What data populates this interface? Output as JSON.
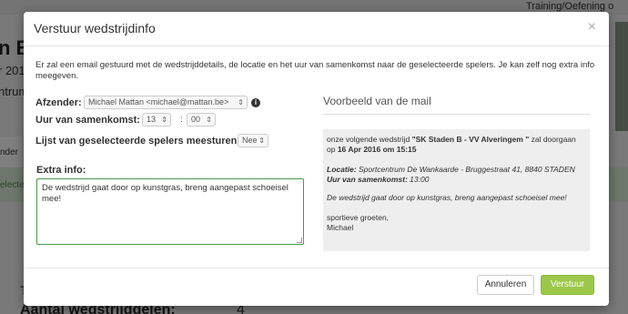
{
  "background": {
    "top_link": "Training/Oefening o",
    "title": "n B",
    "sub1": "r 201",
    "sub2": "ntrum",
    "tab_label": "nder",
    "green_label": "electe",
    "t_label": "T",
    "bottom_label": "Aantal wedstrijddelen:",
    "bottom_value": "4"
  },
  "modal": {
    "title": "Verstuur wedstrijdinfo",
    "close": "×",
    "intro": "Er zal een email gestuurd met de wedstrijddetails, de locatie en het uur van samenkomst naar de geselecteerde spelers. Je kan zelf nog extra info meegeven.",
    "form": {
      "sender_label": "Afzender:",
      "sender_value": "Michael Mattan <michael@mattan.be>",
      "info_icon": "i",
      "time_label": "Uur van samenkomst:",
      "hour": "13",
      "minute": "00",
      "players_label": "Lijst van geselecteerde spelers meesturen:",
      "players_value": "Nee",
      "extra_label": "Extra info:",
      "extra_text": "De wedstrijd gaat door op kunstgras, breng aangepast schoeisel mee!"
    },
    "preview": {
      "title": "Voorbeeld van de mail",
      "line1_a": "onze volgende wedstrijd ",
      "match": "\"SK Staden B - VV Alveringem \"",
      "line1_b": " zal doorgaan op ",
      "date": "16 Apr 2016 om 15:15",
      "location_label": "Locatie:",
      "location_value": " Sportcentrum De Wankaarde - Bruggestraat 41, 8840 STADEN",
      "time_label": "Uur van samenkomst:",
      "time_value": " 13:00",
      "extra": "De wedstrijd gaat door op kunstgras, breng aangepast schoeisel mee!",
      "greeting": "sportieve groeten,",
      "name": "Michael"
    },
    "buttons": {
      "cancel": "Annuleren",
      "send": "Verstuur"
    }
  },
  "colors": {
    "primary": "#9dc74a",
    "textarea_border": "#4a9a4a",
    "preview_bg": "#eeeeee"
  }
}
